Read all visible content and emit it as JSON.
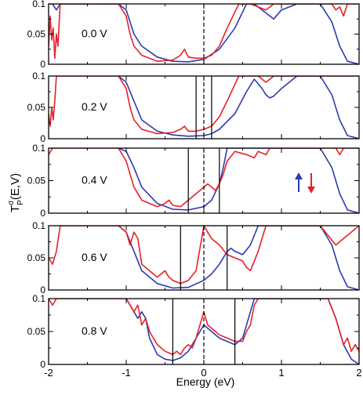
{
  "figure": {
    "ylabel_main": "T",
    "ylabel_sup": "σ",
    "ylabel_sub": "P",
    "ylabel_tail": "(E,V)",
    "xlabel": "Energy (eV)",
    "legend": {
      "up_color": "#2b3bb0",
      "down_color": "#e8202a"
    },
    "xticks": [
      "-2",
      "-1",
      "0",
      "1",
      "2"
    ],
    "yticks": [
      "0",
      "0.05",
      "0.1"
    ],
    "colors": {
      "spin_up": "#2b3bb0",
      "spin_down": "#e8202a"
    }
  },
  "chart_data": [
    {
      "type": "line",
      "label": "0.0 V",
      "xlim": [
        -2,
        2
      ],
      "ylim": [
        0,
        0.1
      ],
      "bias_window": [
        0,
        0
      ],
      "series": [
        {
          "spin": "up",
          "color": "#2b3bb0",
          "x": [
            -2.1,
            -1.95,
            -1.9,
            -1.85,
            -1.1,
            -1.0,
            -0.95,
            -0.9,
            -0.8,
            -0.6,
            -0.4,
            -0.2,
            0,
            0.2,
            0.4,
            0.55,
            0.65,
            0.75,
            0.85,
            0.9,
            1.0,
            1.2,
            1.5,
            1.65,
            1.75,
            1.85,
            2.0
          ],
          "y": [
            0.1,
            0.1,
            0.09,
            0.1,
            0.1,
            0.09,
            0.07,
            0.05,
            0.03,
            0.012,
            0.005,
            0.004,
            0.008,
            0.025,
            0.06,
            0.1,
            0.1,
            0.09,
            0.08,
            0.075,
            0.09,
            0.1,
            0.1,
            0.07,
            0.03,
            0.005,
            0.0
          ]
        },
        {
          "spin": "down",
          "color": "#e8202a",
          "x": [
            -2.1,
            -2.05,
            -2.0,
            -1.98,
            -1.96,
            -1.94,
            -1.92,
            -1.9,
            -1.88,
            -1.86,
            -1.85,
            -1.1,
            -1.0,
            -0.95,
            -0.9,
            -0.8,
            -0.6,
            -0.4,
            -0.3,
            -0.25,
            -0.2,
            -0.1,
            0,
            0.1,
            0.2,
            0.3,
            0.45,
            0.6,
            0.7,
            0.8,
            0.9,
            1.0,
            1.2,
            1.5,
            1.65,
            1.7,
            1.75,
            1.8,
            1.85,
            2.0
          ],
          "y": [
            0.02,
            0.06,
            0.03,
            0.08,
            0.04,
            0.06,
            0.01,
            0.05,
            0.03,
            0.08,
            0.1,
            0.1,
            0.08,
            0.05,
            0.03,
            0.015,
            0.005,
            0.007,
            0.015,
            0.025,
            0.012,
            0.01,
            0.01,
            0.015,
            0.03,
            0.06,
            0.1,
            0.1,
            0.095,
            0.09,
            0.1,
            0.1,
            0.1,
            0.1,
            0.1,
            0.09,
            0.095,
            0.08,
            0.1,
            0.1
          ]
        }
      ]
    },
    {
      "type": "line",
      "label": "0.2 V",
      "xlim": [
        -2,
        2
      ],
      "ylim": [
        0,
        0.1
      ],
      "bias_window": [
        -0.1,
        0.1
      ],
      "series": [
        {
          "spin": "up",
          "color": "#2b3bb0",
          "x": [
            -1.1,
            -1.0,
            -0.9,
            -0.8,
            -0.6,
            -0.4,
            -0.2,
            0,
            0.1,
            0.2,
            0.4,
            0.55,
            0.65,
            0.75,
            0.8,
            0.85,
            0.9,
            1.0,
            1.2,
            1.5,
            1.65,
            1.75,
            1.85,
            2.0
          ],
          "y": [
            0.1,
            0.09,
            0.06,
            0.03,
            0.012,
            0.006,
            0.004,
            0.005,
            0.008,
            0.015,
            0.04,
            0.075,
            0.095,
            0.08,
            0.07,
            0.065,
            0.068,
            0.08,
            0.1,
            0.1,
            0.07,
            0.03,
            0.005,
            0.0
          ]
        },
        {
          "spin": "down",
          "color": "#e8202a",
          "x": [
            -2.1,
            -2.05,
            -2.0,
            -1.98,
            -1.96,
            -1.94,
            -1.92,
            -1.9,
            -1.85,
            -1.1,
            -1.0,
            -0.95,
            -0.9,
            -0.8,
            -0.6,
            -0.4,
            -0.3,
            -0.25,
            -0.2,
            -0.1,
            0,
            0.1,
            0.2,
            0.3,
            0.45,
            0.6,
            0.7,
            0.8,
            0.9,
            1.0,
            1.5,
            1.8,
            2.0
          ],
          "y": [
            0.03,
            0.02,
            0.04,
            0.02,
            0.05,
            0.03,
            0.06,
            0.1,
            0.1,
            0.1,
            0.08,
            0.05,
            0.03,
            0.015,
            0.008,
            0.01,
            0.015,
            0.02,
            0.012,
            0.012,
            0.015,
            0.02,
            0.035,
            0.06,
            0.1,
            0.1,
            0.1,
            0.09,
            0.1,
            0.1,
            0.1,
            0.1,
            0.1
          ]
        }
      ]
    },
    {
      "type": "line",
      "label": "0.4 V",
      "xlim": [
        -2,
        2
      ],
      "ylim": [
        0,
        0.1
      ],
      "bias_window": [
        -0.2,
        0.2
      ],
      "legend": "right-center",
      "series": [
        {
          "spin": "up",
          "color": "#2b3bb0",
          "x": [
            -1.1,
            -1.0,
            -0.9,
            -0.8,
            -0.6,
            -0.4,
            -0.2,
            0,
            0.1,
            0.2,
            0.25,
            0.3,
            0.4,
            1.5,
            1.65,
            1.75,
            1.85,
            2.0
          ],
          "y": [
            0.1,
            0.095,
            0.07,
            0.04,
            0.015,
            0.006,
            0.005,
            0.01,
            0.02,
            0.045,
            0.07,
            0.1,
            0.1,
            0.1,
            0.07,
            0.03,
            0.005,
            0.0
          ]
        },
        {
          "spin": "down",
          "color": "#e8202a",
          "x": [
            -2.1,
            -2.05,
            -2.0,
            -1.95,
            -1.9,
            -1.85,
            -1.1,
            -1.0,
            -0.95,
            -0.9,
            -0.8,
            -0.6,
            -0.5,
            -0.45,
            -0.4,
            -0.3,
            -0.2,
            -0.1,
            0,
            0.05,
            0.1,
            0.15,
            0.2,
            0.25,
            0.3,
            0.4,
            0.55,
            0.65,
            0.7,
            0.8,
            0.85,
            0.9,
            1.0,
            1.5,
            1.7,
            1.75,
            1.8,
            2.0
          ],
          "y": [
            0.1,
            0.08,
            0.09,
            0.1,
            0.1,
            0.1,
            0.1,
            0.08,
            0.06,
            0.04,
            0.02,
            0.01,
            0.015,
            0.02,
            0.012,
            0.01,
            0.02,
            0.03,
            0.04,
            0.045,
            0.04,
            0.035,
            0.045,
            0.06,
            0.08,
            0.095,
            0.09,
            0.085,
            0.095,
            0.09,
            0.1,
            0.1,
            0.1,
            0.1,
            0.1,
            0.09,
            0.1,
            0.1
          ]
        }
      ]
    },
    {
      "type": "line",
      "label": "0.6 V",
      "xlim": [
        -2,
        2
      ],
      "ylim": [
        0,
        0.1
      ],
      "bias_window": [
        -0.3,
        0.3
      ],
      "series": [
        {
          "spin": "up",
          "color": "#2b3bb0",
          "x": [
            -1.1,
            -1.0,
            -0.9,
            -0.8,
            -0.6,
            -0.4,
            -0.2,
            0,
            0.1,
            0.2,
            0.3,
            0.35,
            0.4,
            0.5,
            0.6,
            0.7,
            0.8,
            0.85,
            1.5,
            1.65,
            1.75,
            1.85,
            2.0
          ],
          "y": [
            0.1,
            0.09,
            0.06,
            0.03,
            0.01,
            0.003,
            0.004,
            0.015,
            0.025,
            0.04,
            0.06,
            0.065,
            0.06,
            0.055,
            0.07,
            0.1,
            0.1,
            0.1,
            0.1,
            0.07,
            0.03,
            0.005,
            0.0
          ]
        },
        {
          "spin": "down",
          "color": "#e8202a",
          "x": [
            -2.1,
            -2.05,
            -2.0,
            -1.95,
            -1.9,
            -1.85,
            -1.1,
            -1.0,
            -0.95,
            -0.9,
            -0.85,
            -0.8,
            -0.7,
            -0.6,
            -0.55,
            -0.5,
            -0.45,
            -0.4,
            -0.3,
            -0.2,
            -0.1,
            0,
            0.05,
            0.1,
            0.2,
            0.3,
            0.4,
            0.5,
            0.55,
            0.6,
            0.7,
            0.8,
            1.5,
            1.7,
            1.8,
            2.0
          ],
          "y": [
            0.1,
            0.07,
            0.05,
            0.04,
            0.06,
            0.1,
            0.1,
            0.09,
            0.07,
            0.09,
            0.08,
            0.04,
            0.03,
            0.02,
            0.025,
            0.03,
            0.02,
            0.015,
            0.01,
            0.015,
            0.03,
            0.1,
            0.09,
            0.08,
            0.07,
            0.055,
            0.05,
            0.045,
            0.035,
            0.03,
            0.06,
            0.1,
            0.1,
            0.07,
            0.08,
            0.1
          ]
        }
      ]
    },
    {
      "type": "line",
      "label": "0.8 V",
      "xlim": [
        -2,
        2
      ],
      "ylim": [
        0,
        0.1
      ],
      "bias_window": [
        -0.4,
        0.4
      ],
      "series": [
        {
          "spin": "up",
          "color": "#2b3bb0",
          "x": [
            -1.0,
            -0.9,
            -0.85,
            -0.8,
            -0.75,
            -0.7,
            -0.6,
            -0.5,
            -0.4,
            -0.3,
            -0.2,
            -0.1,
            0,
            0.1,
            0.2,
            0.3,
            0.4,
            0.5,
            0.6,
            0.65,
            0.7,
            0.8,
            1.6,
            1.7,
            1.8,
            1.9,
            2.0
          ],
          "y": [
            0.1,
            0.08,
            0.07,
            0.08,
            0.07,
            0.04,
            0.015,
            0.008,
            0.006,
            0.01,
            0.02,
            0.04,
            0.06,
            0.05,
            0.04,
            0.035,
            0.03,
            0.04,
            0.08,
            0.1,
            0.1,
            0.1,
            0.1,
            0.07,
            0.03,
            0.008,
            0.0
          ]
        },
        {
          "spin": "down",
          "color": "#e8202a",
          "x": [
            -2.1,
            -2.05,
            -2.0,
            -1.95,
            -1.9,
            -1.1,
            -1.0,
            -0.95,
            -0.9,
            -0.85,
            -0.8,
            -0.75,
            -0.7,
            -0.6,
            -0.5,
            -0.4,
            -0.35,
            -0.3,
            -0.25,
            -0.2,
            -0.15,
            -0.1,
            0,
            0.05,
            0.1,
            0.2,
            0.3,
            0.4,
            0.5,
            0.55,
            0.6,
            0.65,
            0.7,
            0.8,
            1.6,
            1.7,
            1.75,
            1.8,
            1.85,
            1.9,
            1.95,
            2.0
          ],
          "y": [
            0.1,
            0.08,
            0.1,
            0.09,
            0.1,
            0.1,
            0.1,
            0.09,
            0.08,
            0.09,
            0.06,
            0.07,
            0.05,
            0.03,
            0.02,
            0.015,
            0.02,
            0.015,
            0.025,
            0.03,
            0.025,
            0.04,
            0.08,
            0.06,
            0.055,
            0.045,
            0.04,
            0.035,
            0.035,
            0.05,
            0.06,
            0.09,
            0.1,
            0.1,
            0.1,
            0.07,
            0.05,
            0.03,
            0.04,
            0.02,
            0.03,
            0.02
          ]
        }
      ]
    }
  ]
}
